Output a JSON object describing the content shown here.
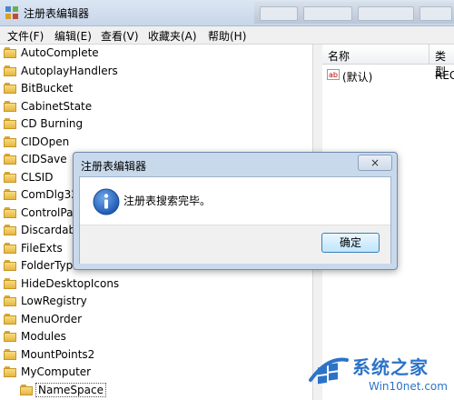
{
  "window": {
    "title": "注册表编辑器"
  },
  "menubar": [
    {
      "label": "文件(F)"
    },
    {
      "label": "编辑(E)"
    },
    {
      "label": "查看(V)"
    },
    {
      "label": "收藏夹(A)"
    },
    {
      "label": "帮助(H)"
    }
  ],
  "tree": {
    "items": [
      {
        "label": "AutoComplete"
      },
      {
        "label": "AutoplayHandlers"
      },
      {
        "label": "BitBucket"
      },
      {
        "label": "CabinetState"
      },
      {
        "label": "CD Burning"
      },
      {
        "label": "CIDOpen"
      },
      {
        "label": "CIDSave"
      },
      {
        "label": "CLSID"
      },
      {
        "label": "ComDlg32"
      },
      {
        "label": "ControlPa"
      },
      {
        "label": "Discardab"
      },
      {
        "label": "FileExts"
      },
      {
        "label": "FolderTypes"
      },
      {
        "label": "HideDesktopIcons"
      },
      {
        "label": "LowRegistry"
      },
      {
        "label": "MenuOrder"
      },
      {
        "label": "Modules"
      },
      {
        "label": "MountPoints2"
      },
      {
        "label": "MyComputer"
      },
      {
        "label": "NameSpace"
      }
    ]
  },
  "list": {
    "columns": {
      "name": "名称",
      "type": "类型"
    },
    "rows": [
      {
        "name": "(默认)",
        "type": "REG"
      }
    ]
  },
  "dialog": {
    "title": "注册表编辑器",
    "close": "×",
    "message": "注册表搜索完毕。",
    "ok_label": "确定"
  },
  "watermark": {
    "text": "系统之家",
    "url": "Win10net.com"
  },
  "colors": {
    "accent": "#2c73c8",
    "folder": "#e6b640",
    "dialog_frame": "#c9d9ec"
  }
}
